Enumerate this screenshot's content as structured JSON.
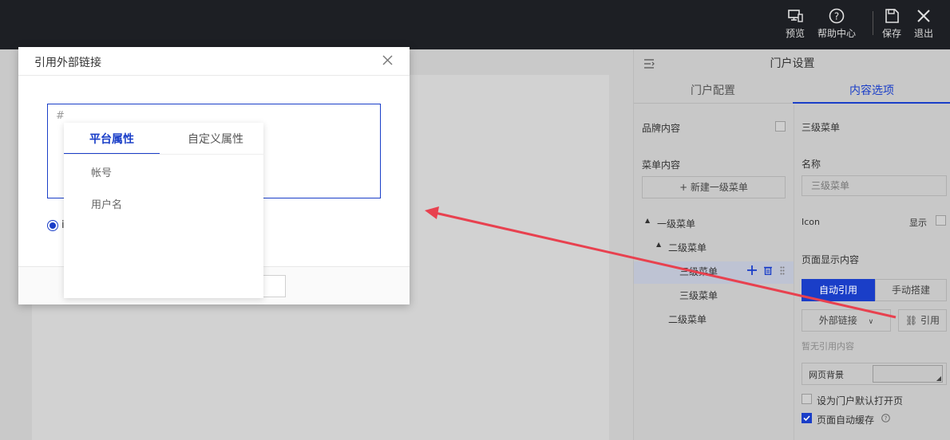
{
  "topbar": {
    "preview": "预览",
    "help": "帮助中心",
    "save": "保存",
    "exit": "退出"
  },
  "panel": {
    "title": "门户设置",
    "tabs": [
      "门户配置",
      "内容选项"
    ],
    "brand_label": "品牌内容",
    "menu_label": "菜单内容",
    "new_menu_button": "+ 新建一级菜单",
    "tree": [
      "一级菜单",
      "二级菜单",
      "三级菜单",
      "三级菜单",
      "二级菜单"
    ],
    "right": {
      "section_title": "三级菜单",
      "name_label": "名称",
      "name_value": "三级菜单",
      "icon_label": "Icon",
      "show_label": "显示",
      "page_content_label": "页面显示内容",
      "auto_ref": "自动引用",
      "manual_build": "手动搭建",
      "link_type": "外部链接",
      "ref_button": "引用",
      "no_ref": "暂无引用内容",
      "bg_label": "网页背景",
      "default_open": "设为门户默认打开页",
      "auto_cache": "页面自动缓存"
    }
  },
  "modal": {
    "title": "引用外部链接",
    "textarea_value": "#",
    "radio_label_partial": "i"
  },
  "dropdown": {
    "tabs": [
      "平台属性",
      "自定义属性"
    ],
    "items": [
      "帐号",
      "用户名"
    ]
  },
  "colors": {
    "accent": "#1a3ec8",
    "arrow": "#e8414f",
    "topbar": "#1d1f24"
  }
}
